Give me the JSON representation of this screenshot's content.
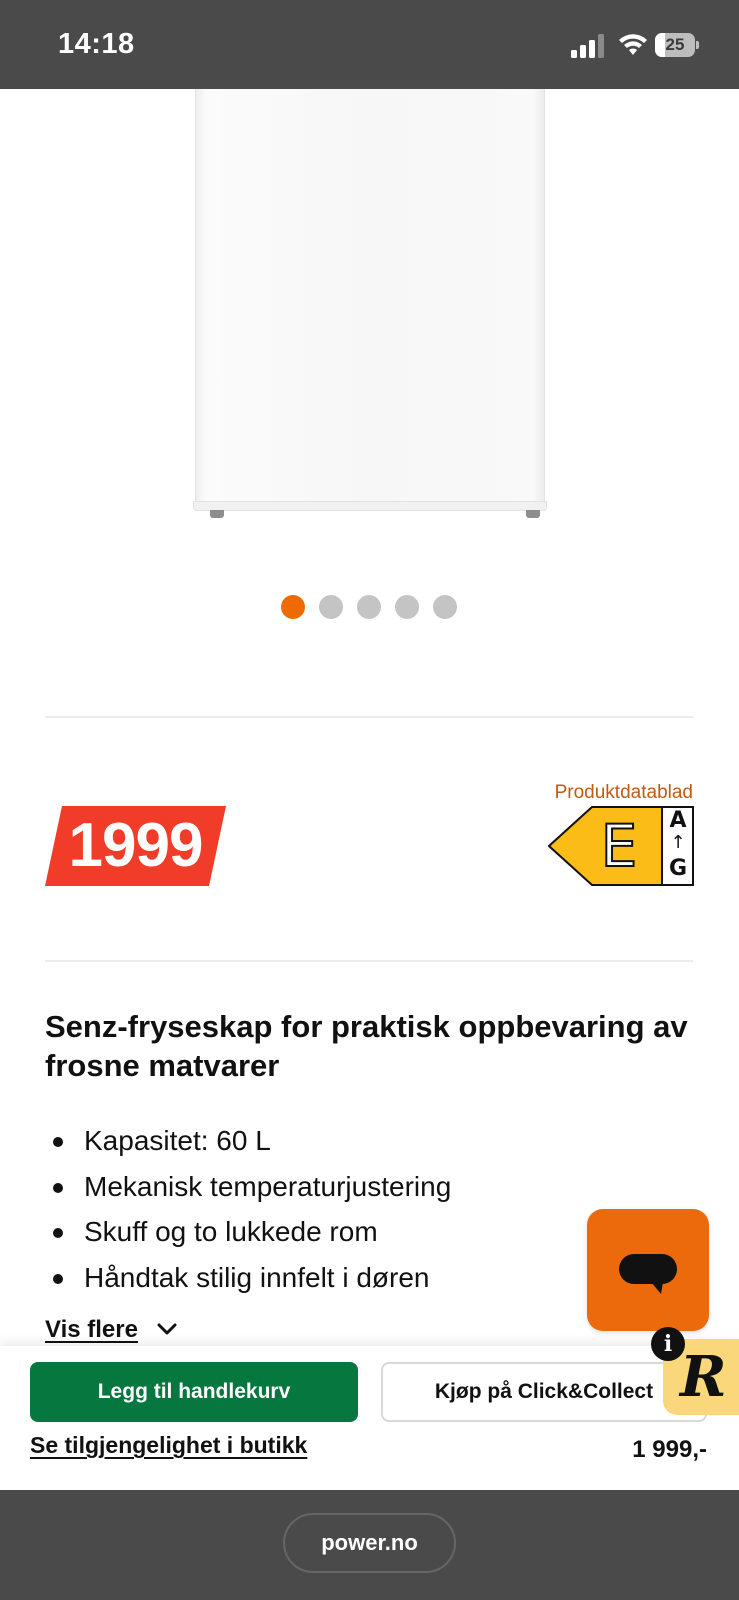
{
  "status_bar": {
    "time": "14:18",
    "battery_percent": "25",
    "icons": [
      "signal-icon",
      "wifi-icon",
      "battery-icon"
    ]
  },
  "product_image": {
    "icon": "fridge-product-image",
    "carousel": {
      "total": 5,
      "active_index": 1
    }
  },
  "price": {
    "amount": "1999",
    "tag_color": "#f03c28"
  },
  "energy": {
    "datasheet_link": "Produktdatablad",
    "class": "E",
    "scale_top": "A",
    "scale_bottom": "G",
    "label_color": "#fbbc18"
  },
  "product": {
    "title": "Senz-fryseskap for praktisk oppbevaring av frosne matvarer",
    "features": [
      "Kapasitet: 60 L",
      "Mekanisk temperaturjustering",
      "Skuff og to lukkede rom",
      "Håndtak stilig innfelt i døren"
    ],
    "show_more": "Vis flere"
  },
  "purchase": {
    "add_to_cart": "Legg til handlekurv",
    "click_collect": "Kjøp på Click&Collect",
    "availability": "Se tilgjengelighet i butikk",
    "price": "1 999,-",
    "add_to_cart_color": "#06773e"
  },
  "widgets": {
    "chat_icon": "chat-bubble-icon",
    "review_letter": "R",
    "info_letter": "i",
    "accent_color": "#ed6a0c"
  },
  "browser": {
    "url": "power.no"
  }
}
